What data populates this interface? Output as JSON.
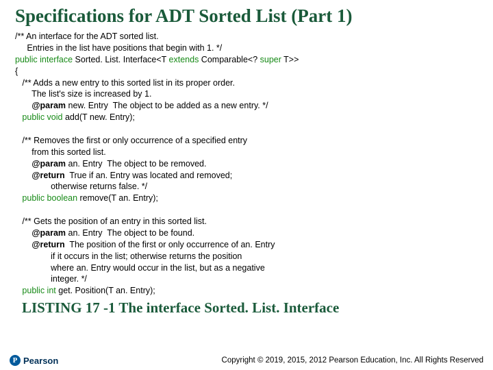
{
  "title": "Specifications for ADT Sorted List (Part 1)",
  "intro_l1": "/** An interface for the ADT sorted list.",
  "intro_l2": "     Entries in the list have positions that begin with 1. */",
  "decl_a": "public interface",
  "decl_b": " Sorted. List. Interface<T ",
  "decl_c": "extends",
  "decl_d": " Comparable<? ",
  "decl_e": "super",
  "decl_f": " T>>",
  "brace_open": "{",
  "add_l1": "   /** Adds a new entry to this sorted list in its proper order.",
  "add_l2": "       The list's size is increased by 1.",
  "add_l3a": "       ",
  "add_l3b": "@param",
  "add_l3c": " new. Entry  The object to be added as a new entry. */",
  "add_sig_a": "public void",
  "add_sig_b": " add(T new. Entry);",
  "rem_l1": "   /** Removes the first or only occurrence of a specified entry",
  "rem_l2": "       from this sorted list.",
  "rem_l3b": "@param",
  "rem_l3c": " an. Entry  The object to be removed.",
  "rem_l4b": "@return",
  "rem_l4c": "  True if an. Entry was located and removed;",
  "rem_l5": "               otherwise returns false. */",
  "rem_sig_a": "public boolean",
  "rem_sig_b": " remove(T an. Entry);",
  "get_l1": "   /** Gets the position of an entry in this sorted list.",
  "get_l2b": "@param",
  "get_l2c": " an. Entry  The object to be found.",
  "get_l3b": "@return",
  "get_l3c": "  The position of the first or only occurrence of an. Entry",
  "get_l4": "               if it occurs in the list; otherwise returns the position",
  "get_l5": "               where an. Entry would occur in the list, but as a negative",
  "get_l6": "               integer. */",
  "get_sig_a": "public int",
  "get_sig_b": " get. Position(T an. Entry);",
  "caption": "LISTING 17 -1 The interface Sorted. List. Interface",
  "publisher": "Pearson",
  "copyright": "Copyright © 2019, 2015, 2012 Pearson Education, Inc. All Rights Reserved"
}
